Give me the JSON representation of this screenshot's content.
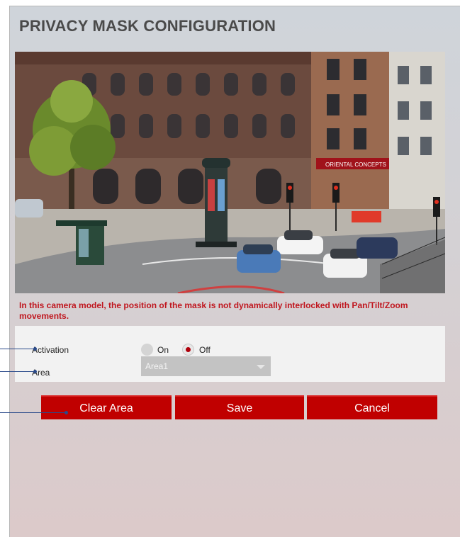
{
  "page": {
    "title": "PRIVACY MASK CONFIGURATION"
  },
  "camera": {
    "sign_text": "ORIENTAL CONCEPTS"
  },
  "warning": "In this camera model, the position of the mask is not dynamically interlocked with Pan/Tilt/Zoom movements.",
  "settings": {
    "activation": {
      "label": "Activation",
      "options": [
        "On",
        "Off"
      ],
      "selected": "Off"
    },
    "area": {
      "label": "Area",
      "value": "Area1"
    }
  },
  "buttons": {
    "clear": "Clear Area",
    "save": "Save",
    "cancel": "Cancel"
  },
  "colors": {
    "accent": "#c00000",
    "warning": "#c0161e",
    "leader": "#2a4a8a"
  }
}
